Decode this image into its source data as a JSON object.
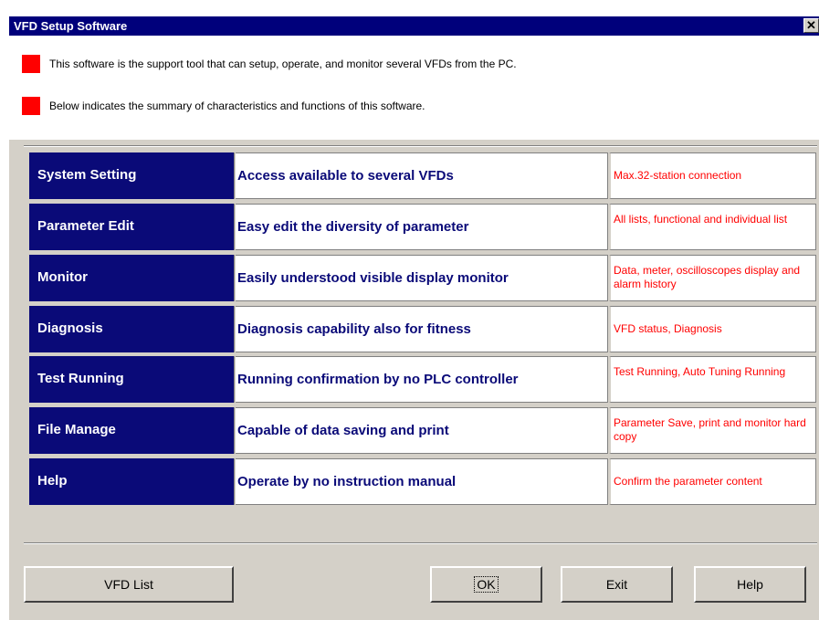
{
  "window": {
    "title": "VFD Setup Software",
    "close_glyph": "✕"
  },
  "intro": {
    "bullet_color": "#ff0000",
    "lines": [
      "This software is the support tool that can setup, operate, and monitor several VFDs from the PC.",
      "Below indicates the summary of characteristics and functions of this software."
    ]
  },
  "features": [
    {
      "name": "System Setting",
      "description": "Access available to several VFDs",
      "note": "Max.32-station connection"
    },
    {
      "name": "Parameter Edit",
      "description": "Easy edit the diversity of parameter",
      "note": "All lists, functional and individual list"
    },
    {
      "name": "Monitor",
      "description": "Easily understood visible display monitor",
      "note": "Data, meter, oscilloscopes display and alarm history"
    },
    {
      "name": "Diagnosis",
      "description": "Diagnosis capability also for fitness",
      "note": "VFD status, Diagnosis"
    },
    {
      "name": "Test Running",
      "description": "Running confirmation by no PLC controller",
      "note": "Test Running, Auto Tuning Running"
    },
    {
      "name": "File Manage",
      "description": "Capable of data saving and print",
      "note": "Parameter Save, print and monitor hard copy"
    },
    {
      "name": "Help",
      "description": "Operate by no instruction manual",
      "note": "Confirm the parameter content"
    }
  ],
  "buttons": {
    "vfd_list": "VFD List",
    "ok": "OK",
    "exit": "Exit",
    "help": "Help"
  },
  "colors": {
    "title_bar": "#00007b",
    "feature_name_bg": "#0a0a78",
    "feature_desc_text": "#0a0a78",
    "feature_note_text": "#ff0000",
    "dialog_bg": "#d4d0c8"
  }
}
